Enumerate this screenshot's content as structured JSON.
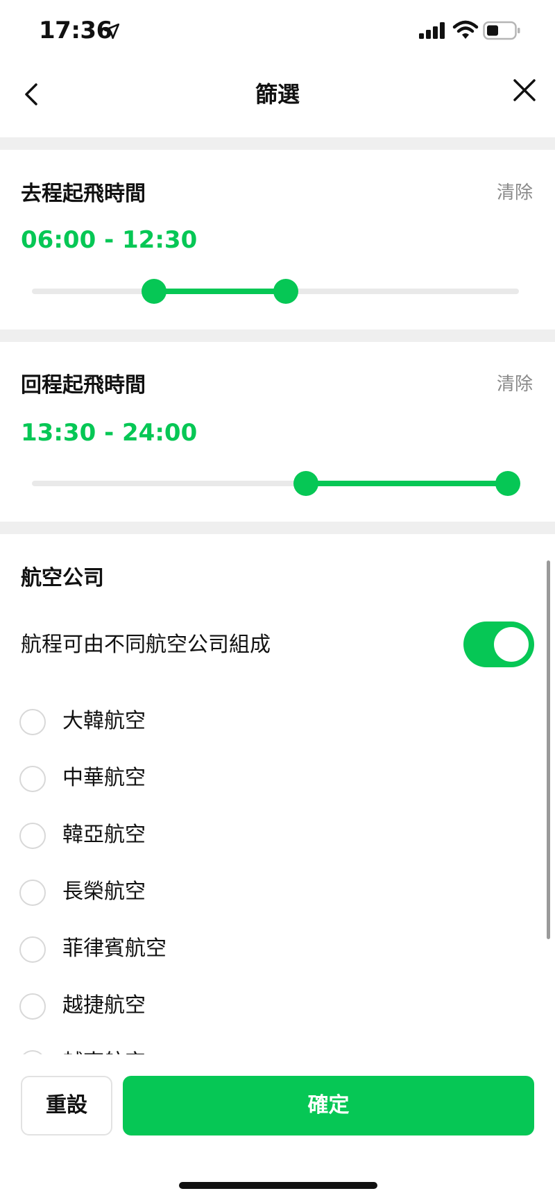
{
  "status_bar": {
    "time": "17:36",
    "icons": [
      "location-arrow-icon",
      "cellular-signal-icon",
      "wifi-icon",
      "battery-icon"
    ]
  },
  "nav": {
    "title": "篩選",
    "back_icon": "chevron-left-icon",
    "close_icon": "close-icon"
  },
  "departure": {
    "title": "去程起飛時間",
    "clear_label": "清除",
    "range_text": "06:00 - 12:30",
    "range_start": "06:00",
    "range_end": "12:30",
    "slider_min": 0,
    "slider_max": 24,
    "value_start": 6,
    "value_end": 12.5
  },
  "return": {
    "title": "回程起飛時間",
    "clear_label": "清除",
    "range_text": "13:30 - 24:00",
    "range_start": "13:30",
    "range_end": "24:00",
    "slider_min": 0,
    "slider_max": 24,
    "value_start": 13.5,
    "value_end": 24
  },
  "airlines": {
    "title": "航空公司",
    "mixed_carriers_label": "航程可由不同航空公司組成",
    "mixed_carriers_enabled": true,
    "items": [
      {
        "label": "大韓航空",
        "checked": false
      },
      {
        "label": "中華航空",
        "checked": false
      },
      {
        "label": "韓亞航空",
        "checked": false
      },
      {
        "label": "長榮航空",
        "checked": false
      },
      {
        "label": "菲律賓航空",
        "checked": false
      },
      {
        "label": "越捷航空",
        "checked": false
      },
      {
        "label": "越南航空",
        "checked": false
      }
    ]
  },
  "footer": {
    "reset_label": "重設",
    "confirm_label": "確定"
  },
  "colors": {
    "accent": "#06c755",
    "track": "#e9e9e9",
    "band": "#efefef",
    "muted_text": "#8a8a8a"
  }
}
